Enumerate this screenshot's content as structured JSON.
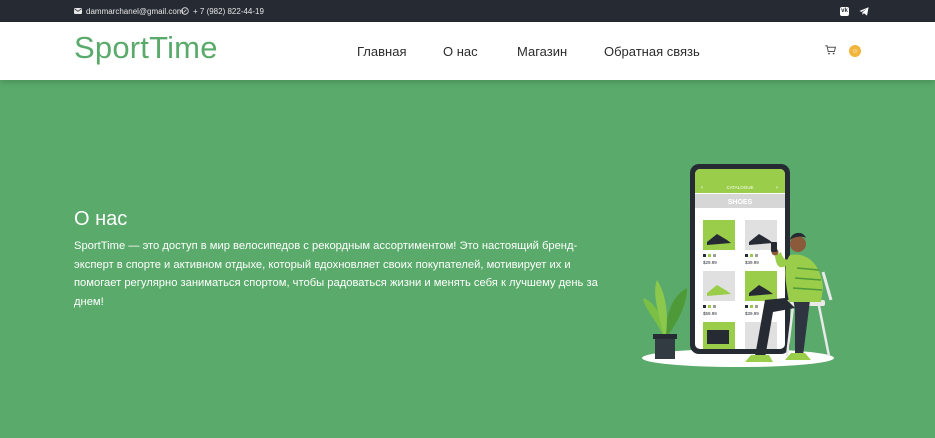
{
  "topbar": {
    "email": "dammarchanel@gmail.com",
    "phone": "+ 7 (982) 822-44-19",
    "social": [
      "vk-icon",
      "telegram-icon"
    ]
  },
  "header": {
    "logo": "SportTime",
    "nav": [
      {
        "label": "Главная"
      },
      {
        "label": "О нас"
      },
      {
        "label": "Магазин"
      },
      {
        "label": "Обратная связь"
      }
    ],
    "icons": [
      "cart-icon",
      "user-icon"
    ]
  },
  "about": {
    "title": "О нас",
    "text": "SportTime — это доступ в мир велосипедов с рекордным ассортиментом! Это настоящий бренд-эксперт в спорте и активном отдыхе, который вдохновляет своих покупателей, мотивирует их и помогает регулярно заниматься спортом, чтобы радоваться жизни и менять себя к лучшему день за днем!"
  },
  "illustration": {
    "app_header": "CATALOGUE",
    "app_section": "SHOES",
    "prices": [
      "$29.99",
      "$39.99",
      "$59.99",
      "$39.99"
    ]
  },
  "colors": {
    "brand_green": "#5aab6b",
    "topbar": "#262a33",
    "lime": "#9acd4a"
  }
}
